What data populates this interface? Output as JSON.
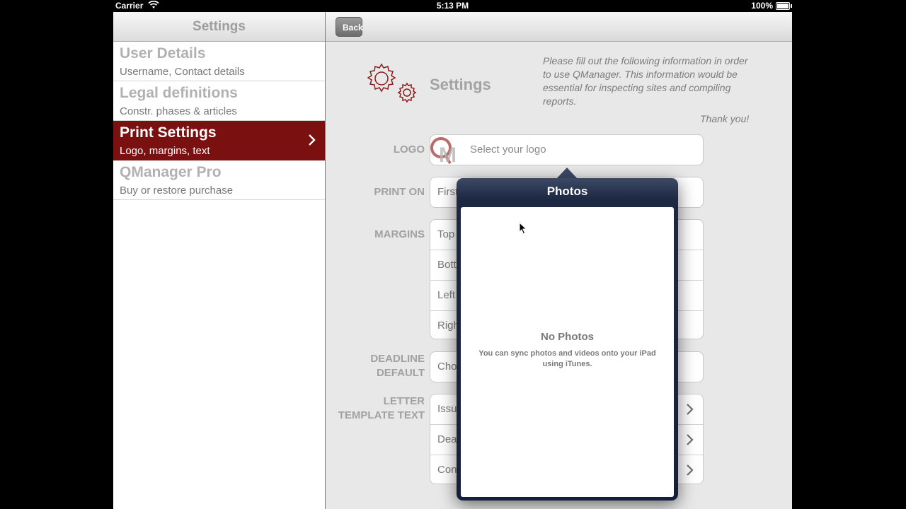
{
  "status_bar": {
    "carrier": "Carrier",
    "time": "5:13 PM",
    "battery": "100%"
  },
  "master": {
    "nav_title": "Settings",
    "items": [
      {
        "title": "User Details",
        "subtitle": "Username, Contact details"
      },
      {
        "title": "Legal definitions",
        "subtitle": "Constr. phases & articles"
      },
      {
        "title": "Print Settings",
        "subtitle": "Logo, margins, text"
      },
      {
        "title": "QManager Pro",
        "subtitle": "Buy or restore purchase"
      }
    ],
    "selected_index": 2,
    "accent_color": "#7a1010"
  },
  "detail": {
    "back_label": "Back",
    "title": "Settings",
    "intro": "Please fill out the following information in order to use QManager. This information would be essential for inspecting sites and compiling reports.",
    "thanks": "Thank you!",
    "logo": {
      "label": "LOGO",
      "placeholder": "Select your logo"
    },
    "print_on": {
      "label": "PRINT ON",
      "value": "First"
    },
    "margins": {
      "label": "MARGINS",
      "rows": [
        "Top",
        "Bott",
        "Left",
        "Righ"
      ]
    },
    "deadline": {
      "label_line1": "DEADLINE",
      "label_line2": "DEFAULT",
      "value": "Cho"
    },
    "letter": {
      "label_line1": "LETTER",
      "label_line2": "TEMPLATE TEXT",
      "rows": [
        "Issu",
        "Dea",
        "Con"
      ]
    }
  },
  "popover": {
    "title": "Photos",
    "empty_title": "No Photos",
    "empty_message": "You can sync photos and videos onto your iPad using iTunes."
  }
}
